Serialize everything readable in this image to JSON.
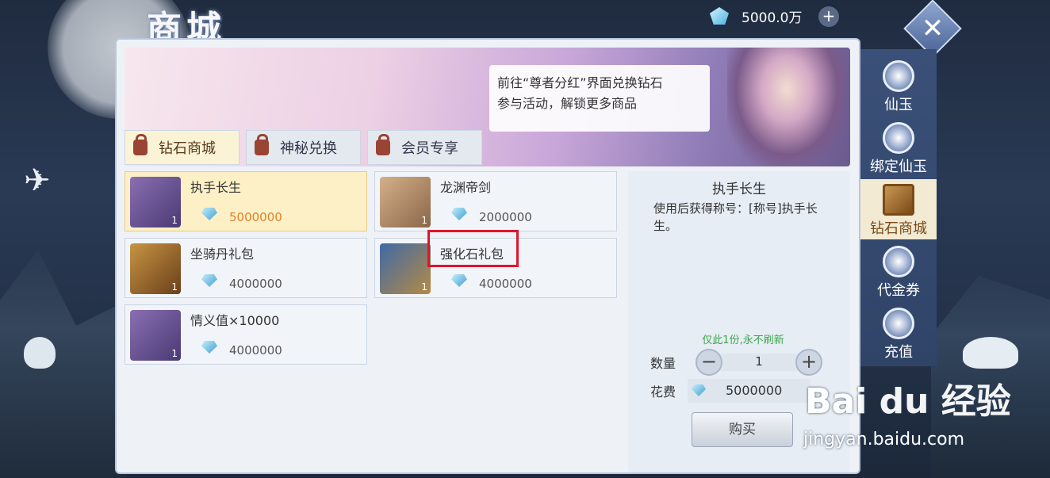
{
  "header": {
    "title": "商城",
    "currency_amount": "5000.0万",
    "add_label": "+",
    "close_label": "✕"
  },
  "banner": {
    "message_line1": "前往“尊者分红”界面兑换钻石",
    "message_line2": "参与活动，解锁更多商品"
  },
  "tabs": [
    {
      "label": "钻石商城",
      "active": true
    },
    {
      "label": "神秘兑换",
      "active": false
    },
    {
      "label": "会员专享",
      "active": false
    }
  ],
  "items": [
    {
      "name": "执手长生",
      "qty": "1",
      "price": "5000000",
      "selected": true
    },
    {
      "name": "龙渊帝剑",
      "qty": "1",
      "price": "2000000",
      "selected": false
    },
    {
      "name": "坐骑丹礼包",
      "qty": "1",
      "price": "4000000",
      "selected": false
    },
    {
      "name": "强化石礼包",
      "qty": "1",
      "price": "4000000",
      "selected": false
    },
    {
      "name": "情义值×10000",
      "qty": "1",
      "price": "4000000",
      "selected": false
    }
  ],
  "detail": {
    "title": "执手长生",
    "description": "使用后获得称号：[称号]执手长生。",
    "limit_note": "仅此1份,永不刷新",
    "quantity_label": "数量",
    "quantity_value": "1",
    "minus_label": "−",
    "plus_label": "+",
    "cost_label": "花费",
    "cost_value": "5000000",
    "buy_label": "购买"
  },
  "sidebar": [
    {
      "label": "仙玉",
      "active": false
    },
    {
      "label": "绑定仙玉",
      "active": false
    },
    {
      "label": "钻石商城",
      "active": true
    },
    {
      "label": "代金券",
      "active": false
    },
    {
      "label": "充值",
      "active": false
    }
  ],
  "watermark": {
    "main": "Bai du 经验",
    "sub": "jingyan.baidu.com"
  }
}
